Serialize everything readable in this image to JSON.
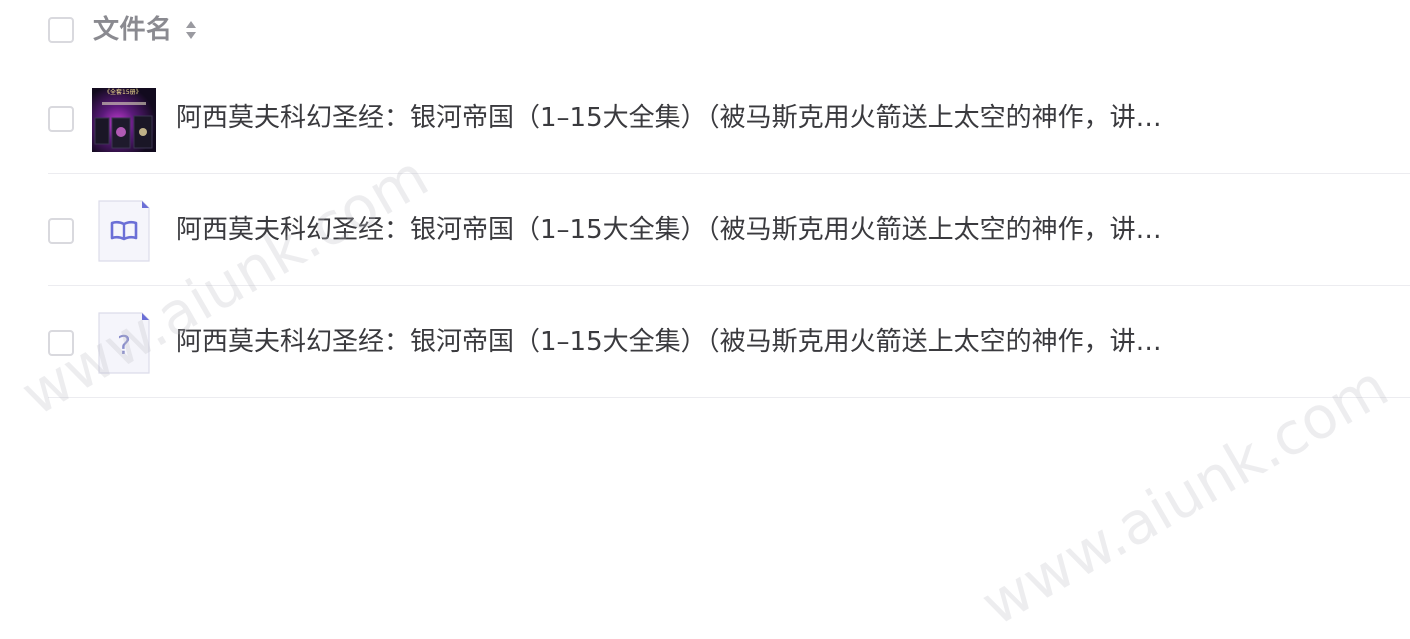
{
  "header": {
    "column_title": "文件名",
    "sort_icon": "sort-both-icon"
  },
  "files": [
    {
      "name": "阿西莫夫科幻圣经：银河帝国（1–15大全集）（被马斯克用火箭送上太空的神作，讲…",
      "icon": "book-cover-thumbnail",
      "cover_label": "《全套15册》"
    },
    {
      "name": "阿西莫夫科幻圣经：银河帝国（1–15大全集）（被马斯克用火箭送上太空的神作，讲…",
      "icon": "ebook-icon"
    },
    {
      "name": "阿西莫夫科幻圣经：银河帝国（1–15大全集）（被马斯克用火箭送上太空的神作，讲…",
      "icon": "unknown-file-icon",
      "glyph": "?"
    }
  ],
  "watermarks": [
    "www.aiunk.com",
    "www.aiunk.com"
  ],
  "colors": {
    "accent": "#6b6fd6",
    "text": "#3a3a3e",
    "header_text": "#8a8a90",
    "divider": "#ececf0"
  }
}
